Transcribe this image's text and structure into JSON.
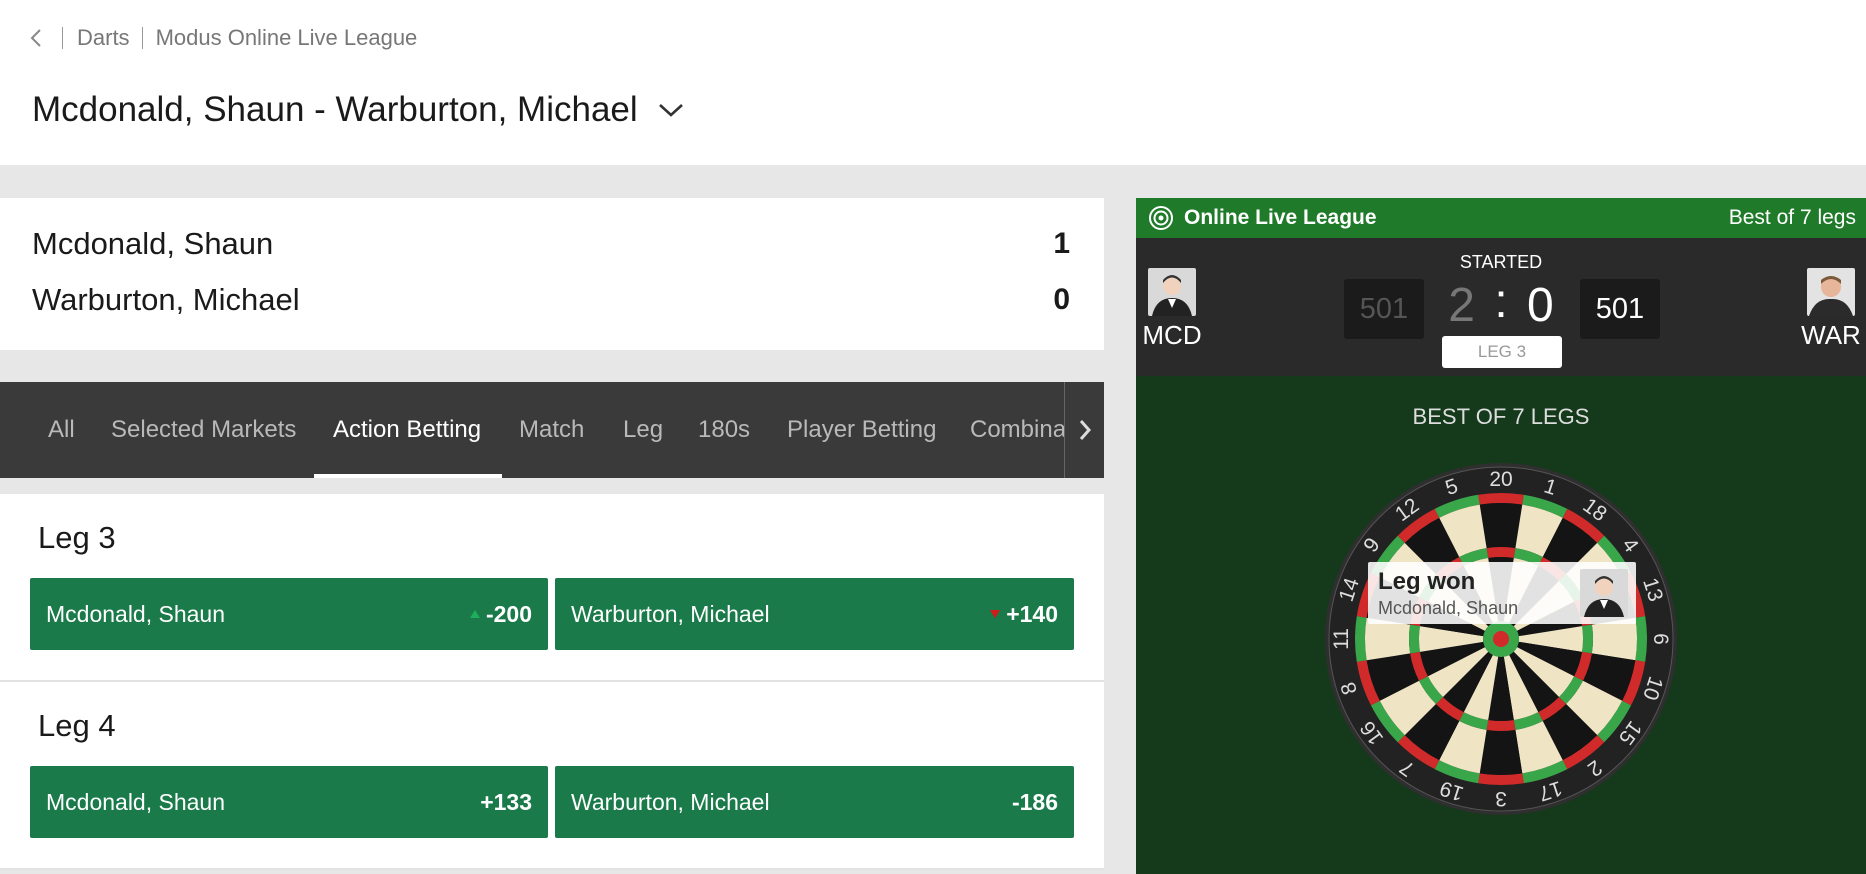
{
  "breadcrumb": {
    "back_icon": "chevron-left-icon",
    "items": [
      "Darts",
      "Modus Online Live League"
    ]
  },
  "match": {
    "title": "Mcdonald, Shaun - Warburton, Michael",
    "dropdown_icon": "chevron-down-icon"
  },
  "score": {
    "rows": [
      {
        "name": "Mcdonald, Shaun",
        "value": "1"
      },
      {
        "name": "Warburton, Michael",
        "value": "0"
      }
    ]
  },
  "tabs": {
    "items": [
      "All",
      "Selected Markets",
      "Action Betting",
      "Match",
      "Leg",
      "180s",
      "Player Betting",
      "Combina"
    ],
    "active_index": 2,
    "arrow_icon": "chevron-right-icon"
  },
  "markets": [
    {
      "title": "Leg 3",
      "odds": [
        {
          "name": "Mcdonald, Shaun",
          "value": "-200",
          "trend": "up"
        },
        {
          "name": "Warburton, Michael",
          "value": "+140",
          "trend": "down"
        }
      ]
    },
    {
      "title": "Leg 4",
      "odds": [
        {
          "name": "Mcdonald, Shaun",
          "value": "+133",
          "trend": ""
        },
        {
          "name": "Warburton, Michael",
          "value": "-186",
          "trend": ""
        }
      ]
    }
  ],
  "livepanel": {
    "league": "Online Live League",
    "league_icon": "target-icon",
    "format": "Best of 7 legs",
    "status": "STARTED",
    "home": {
      "code": "MCD",
      "remaining": "501"
    },
    "away": {
      "code": "WAR",
      "remaining": "501"
    },
    "legs_home": "2",
    "legs_sep": ":",
    "legs_away": "0",
    "current_leg": "LEG 3",
    "best_of": "BEST OF 7 LEGS",
    "event": {
      "title": "Leg won",
      "player": "Mcdonald, Shaun"
    }
  },
  "colors": {
    "accent_green": "#1a7a4a",
    "panel_header": "#1f7a2a",
    "panel_bg": "#14391b",
    "tab_bar": "#3a3a3a",
    "odds_up": "#1fae5a",
    "odds_down": "#d11a1a"
  }
}
